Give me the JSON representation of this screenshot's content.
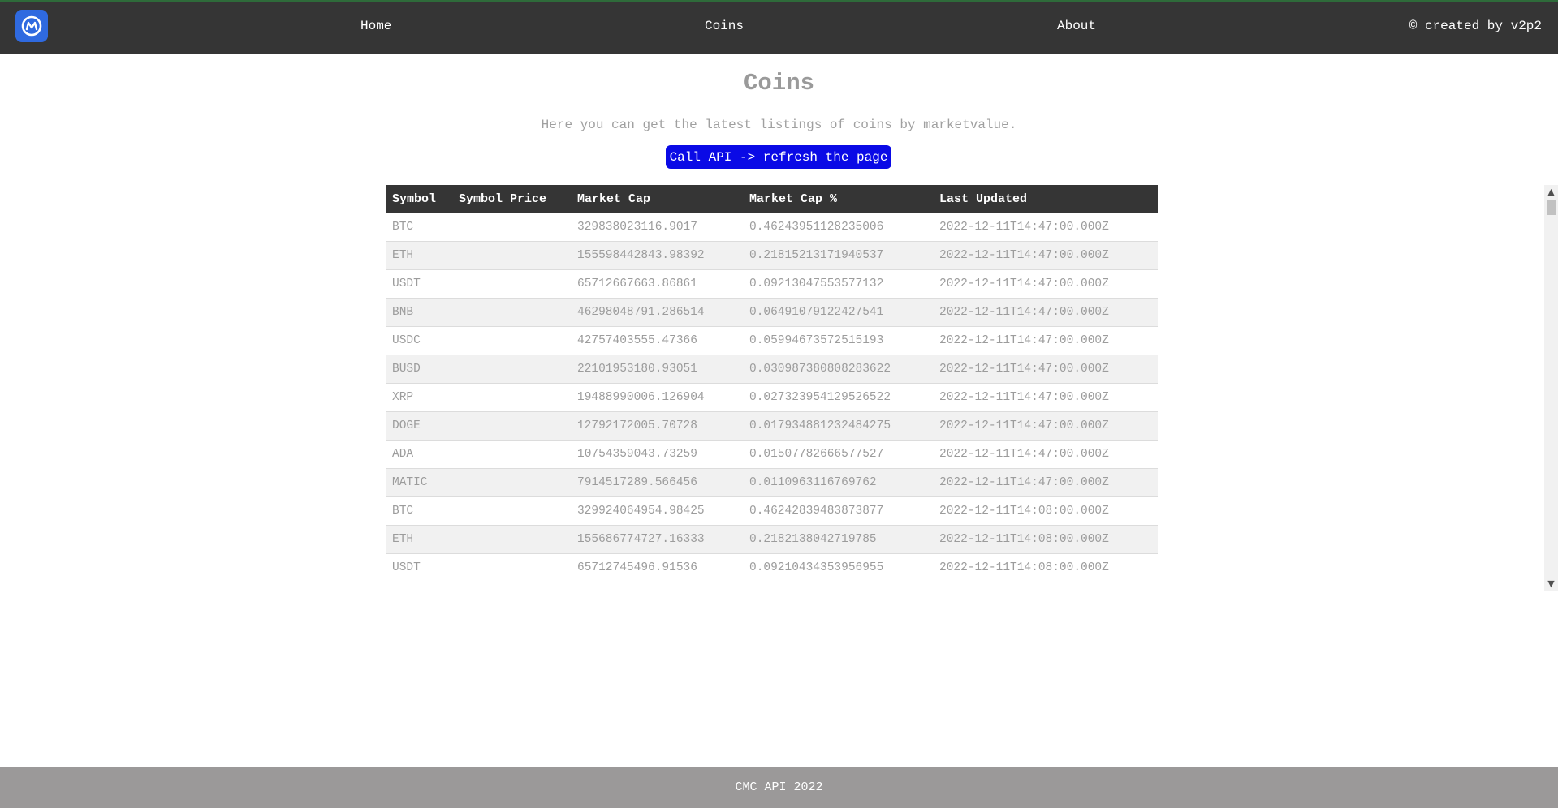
{
  "header": {
    "nav": [
      {
        "label": "Home"
      },
      {
        "label": "Coins"
      },
      {
        "label": "About"
      }
    ],
    "credit": "© created by v2p2",
    "logo_icon": "coinmarketcap-logo-icon",
    "background": "#353535"
  },
  "main": {
    "title": "Coins",
    "subtitle": "Here you can get the latest listings of coins by marketvalue.",
    "button_label": "Call API -> refresh the page",
    "button_color": "#0a0ae6"
  },
  "table": {
    "columns": [
      "Symbol",
      "Symbol Price",
      "Market Cap",
      "Market Cap %",
      "Last Updated"
    ],
    "rows": [
      {
        "symbol": "BTC",
        "price": "",
        "market_cap": "329838023116.9017",
        "market_cap_pct": "0.46243951128235006",
        "last_updated": "2022-12-11T14:47:00.000Z"
      },
      {
        "symbol": "ETH",
        "price": "",
        "market_cap": "155598442843.98392",
        "market_cap_pct": "0.21815213171940537",
        "last_updated": "2022-12-11T14:47:00.000Z"
      },
      {
        "symbol": "USDT",
        "price": "",
        "market_cap": "65712667663.86861",
        "market_cap_pct": "0.09213047553577132",
        "last_updated": "2022-12-11T14:47:00.000Z"
      },
      {
        "symbol": "BNB",
        "price": "",
        "market_cap": "46298048791.286514",
        "market_cap_pct": "0.06491079122427541",
        "last_updated": "2022-12-11T14:47:00.000Z"
      },
      {
        "symbol": "USDC",
        "price": "",
        "market_cap": "42757403555.47366",
        "market_cap_pct": "0.05994673572515193",
        "last_updated": "2022-12-11T14:47:00.000Z"
      },
      {
        "symbol": "BUSD",
        "price": "",
        "market_cap": "22101953180.93051",
        "market_cap_pct": "0.030987380808283622",
        "last_updated": "2022-12-11T14:47:00.000Z"
      },
      {
        "symbol": "XRP",
        "price": "",
        "market_cap": "19488990006.126904",
        "market_cap_pct": "0.027323954129526522",
        "last_updated": "2022-12-11T14:47:00.000Z"
      },
      {
        "symbol": "DOGE",
        "price": "",
        "market_cap": "12792172005.70728",
        "market_cap_pct": "0.017934881232484275",
        "last_updated": "2022-12-11T14:47:00.000Z"
      },
      {
        "symbol": "ADA",
        "price": "",
        "market_cap": "10754359043.73259",
        "market_cap_pct": "0.01507782666577527",
        "last_updated": "2022-12-11T14:47:00.000Z"
      },
      {
        "symbol": "MATIC",
        "price": "",
        "market_cap": "7914517289.566456",
        "market_cap_pct": "0.0110963116769762",
        "last_updated": "2022-12-11T14:47:00.000Z"
      },
      {
        "symbol": "BTC",
        "price": "",
        "market_cap": "329924064954.98425",
        "market_cap_pct": "0.46242839483873877",
        "last_updated": "2022-12-11T14:08:00.000Z"
      },
      {
        "symbol": "ETH",
        "price": "",
        "market_cap": "155686774727.16333",
        "market_cap_pct": "0.2182138042719785",
        "last_updated": "2022-12-11T14:08:00.000Z"
      },
      {
        "symbol": "USDT",
        "price": "",
        "market_cap": "65712745496.91536",
        "market_cap_pct": "0.09210434353956955",
        "last_updated": "2022-12-11T14:08:00.000Z"
      }
    ]
  },
  "footer": {
    "text": "CMC API 2022"
  }
}
